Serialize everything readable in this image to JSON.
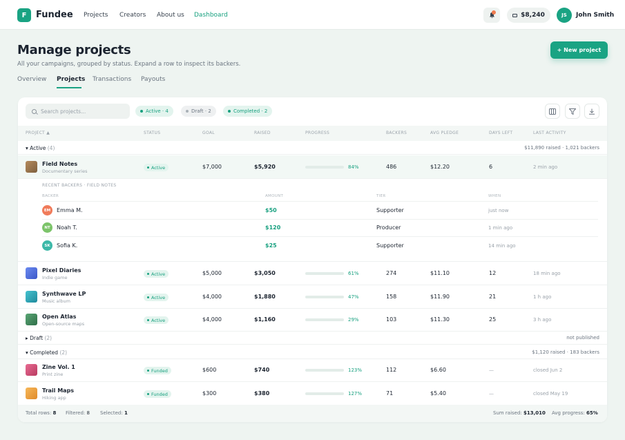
{
  "brand": {
    "initial": "F",
    "name": "Fundee"
  },
  "nav": [
    {
      "label": "Projects"
    },
    {
      "label": "Creators"
    },
    {
      "label": "About us"
    },
    {
      "label": "Dashboard"
    }
  ],
  "user": {
    "notifications": "3",
    "balance": "$8,240",
    "initials": "JS",
    "name": "John Smith"
  },
  "page": {
    "title": "Manage projects",
    "subtitle": "All your campaigns, grouped by status. Expand a row to inspect its backers.",
    "new_button": "+ New project"
  },
  "tabs": [
    {
      "label": "Overview"
    },
    {
      "label": "Projects"
    },
    {
      "label": "Transactions"
    },
    {
      "label": "Payouts"
    }
  ],
  "toolbar": {
    "search_placeholder": "Search projects...",
    "chips": [
      {
        "label": "Active · 4"
      },
      {
        "label": "Draft · 2"
      },
      {
        "label": "Completed · 2"
      }
    ]
  },
  "columns": [
    "PROJECT ▲",
    "STATUS",
    "GOAL",
    "RAISED",
    "PROGRESS",
    "BACKERS",
    "AVG PLEDGE",
    "DAYS LEFT",
    "LAST ACTIVITY"
  ],
  "groups": {
    "active": {
      "label": "Active",
      "count": "(4)",
      "summary": "$11,890 raised · 1,021 backers"
    },
    "draft": {
      "label": "Draft",
      "count": "(2)",
      "summary": "not published"
    },
    "completed": {
      "label": "Completed",
      "count": "(2)",
      "summary": "$1,120 raised · 183 backers"
    }
  },
  "rows": [
    {
      "name": "Field Notes",
      "category": "Documentary series",
      "status": "Active",
      "goal": "$7,000",
      "raised": "$5,920",
      "progress": 0.84,
      "progress_label": "84%",
      "backers": "486",
      "avg": "$12.20",
      "days": "6",
      "activity": "2 min ago",
      "color": "#a07a52"
    },
    {
      "name": "Pixel Diaries",
      "category": "Indie game",
      "status": "Active",
      "goal": "$5,000",
      "raised": "$3,050",
      "progress": 0.61,
      "progress_label": "61%",
      "backers": "274",
      "avg": "$11.10",
      "days": "12",
      "activity": "18 min ago",
      "color": "#4b6fe0"
    },
    {
      "name": "Synthwave LP",
      "category": "Music album",
      "status": "Active",
      "goal": "$4,000",
      "raised": "$1,880",
      "progress": 0.47,
      "progress_label": "47%",
      "backers": "158",
      "avg": "$11.90",
      "days": "21",
      "activity": "1 h ago",
      "color": "#2aa6b8"
    },
    {
      "name": "Open Atlas",
      "category": "Open-source maps",
      "status": "Active",
      "goal": "$4,000",
      "raised": "$1,160",
      "progress": 0.29,
      "progress_label": "29%",
      "backers": "103",
      "avg": "$11.30",
      "days": "25",
      "activity": "3 h ago",
      "color": "#3f8a5c"
    },
    {
      "name": "Zine Vol. 1",
      "category": "Print zine",
      "status": "Funded",
      "goal": "$600",
      "raised": "$740",
      "progress": 1.0,
      "progress_label": "123%",
      "backers": "112",
      "avg": "$6.60",
      "days": "—",
      "activity": "closed Jun 2",
      "color": "#d9507a"
    },
    {
      "name": "Trail Maps",
      "category": "Hiking app",
      "status": "Funded",
      "goal": "$300",
      "raised": "$380",
      "progress": 1.0,
      "progress_label": "127%",
      "backers": "71",
      "avg": "$5.40",
      "days": "—",
      "activity": "closed May 19",
      "color": "#f0a040"
    }
  ],
  "expanded": {
    "title": "RECENT BACKERS · FIELD NOTES",
    "headers": [
      "BACKER",
      "AMOUNT",
      "TIER",
      "WHEN"
    ],
    "backers": [
      {
        "initials": "EM",
        "name": "Emma M.",
        "amount": "$50",
        "tier": "Supporter",
        "when": "just now",
        "color": "#f07b5a"
      },
      {
        "initials": "NT",
        "name": "Noah T.",
        "amount": "$120",
        "tier": "Producer",
        "when": "1 min ago",
        "color": "#7cc46a"
      },
      {
        "initials": "SK",
        "name": "Sofia K.",
        "amount": "$25",
        "tier": "Supporter",
        "when": "14 min ago",
        "color": "#3cb8a8"
      }
    ]
  },
  "footer": {
    "total_label": "Total rows:",
    "total": "8",
    "filtered_label": "Filtered:",
    "filtered": "8",
    "selected_label": "Selected:",
    "selected": "1",
    "sum_label": "Sum raised:",
    "sum": "$13,010",
    "avg_label": "Avg progress:",
    "avg": "65%"
  },
  "colors": {
    "accent": "#1aa383",
    "background": "#eef4f1"
  }
}
